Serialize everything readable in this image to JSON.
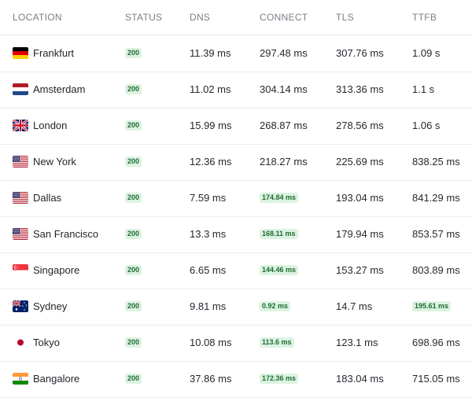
{
  "table": {
    "headers": [
      "LOCATION",
      "STATUS",
      "DNS",
      "CONNECT",
      "TLS",
      "TTFB"
    ],
    "rows": [
      {
        "location": "Frankfurt",
        "flag": "de",
        "status": "200",
        "dns": "11.39 ms",
        "connect": "297.48 ms",
        "tls": "307.76 ms",
        "ttfb": "1.09 s",
        "connect_best": false,
        "ttfb_best": false
      },
      {
        "location": "Amsterdam",
        "flag": "nl",
        "status": "200",
        "dns": "11.02 ms",
        "connect": "304.14 ms",
        "tls": "313.36 ms",
        "ttfb": "1.1 s",
        "connect_best": false,
        "ttfb_best": false
      },
      {
        "location": "London",
        "flag": "gb",
        "status": "200",
        "dns": "15.99 ms",
        "connect": "268.87 ms",
        "tls": "278.56 ms",
        "ttfb": "1.06 s",
        "connect_best": false,
        "ttfb_best": false
      },
      {
        "location": "New York",
        "flag": "us",
        "status": "200",
        "dns": "12.36 ms",
        "connect": "218.27 ms",
        "tls": "225.69 ms",
        "ttfb": "838.25 ms",
        "connect_best": false,
        "ttfb_best": false
      },
      {
        "location": "Dallas",
        "flag": "us",
        "status": "200",
        "dns": "7.59 ms",
        "connect": "174.84 ms",
        "tls": "193.04 ms",
        "ttfb": "841.29 ms",
        "connect_best": true,
        "ttfb_best": false
      },
      {
        "location": "San Francisco",
        "flag": "us",
        "status": "200",
        "dns": "13.3 ms",
        "connect": "168.11 ms",
        "tls": "179.94 ms",
        "ttfb": "853.57 ms",
        "connect_best": true,
        "ttfb_best": false
      },
      {
        "location": "Singapore",
        "flag": "sg",
        "status": "200",
        "dns": "6.65 ms",
        "connect": "144.46 ms",
        "tls": "153.27 ms",
        "ttfb": "803.89 ms",
        "connect_best": true,
        "ttfb_best": false
      },
      {
        "location": "Sydney",
        "flag": "au",
        "status": "200",
        "dns": "9.81 ms",
        "connect": "0.92 ms",
        "tls": "14.7 ms",
        "ttfb": "195.61 ms",
        "connect_best": true,
        "ttfb_best": true
      },
      {
        "location": "Tokyo",
        "flag": "jp",
        "status": "200",
        "dns": "10.08 ms",
        "connect": "113.6 ms",
        "tls": "123.1 ms",
        "ttfb": "698.96 ms",
        "connect_best": true,
        "ttfb_best": false
      },
      {
        "location": "Bangalore",
        "flag": "in",
        "status": "200",
        "dns": "37.86 ms",
        "connect": "172.36 ms",
        "tls": "183.04 ms",
        "ttfb": "715.05 ms",
        "connect_best": true,
        "ttfb_best": false
      }
    ]
  },
  "colors": {
    "badge_bg": "#dcf3e1",
    "badge_text": "#1f6b33",
    "header_text": "#7a7f87",
    "row_border": "#ececf0"
  }
}
